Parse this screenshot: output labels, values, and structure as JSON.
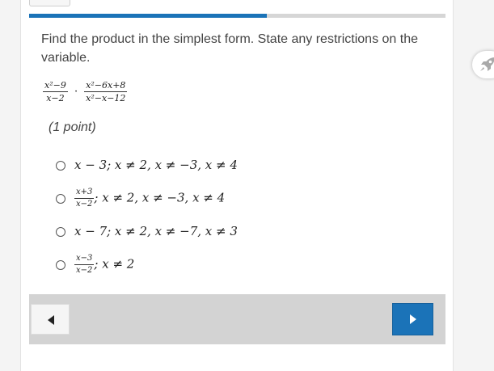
{
  "progress": {
    "fraction": 0.57
  },
  "question": {
    "prompt": "Find the product in the simplest form. State any restrictions on the variable.",
    "expression": {
      "first_num": "x²−9",
      "first_den": "x−2",
      "operator": "·",
      "second_num": "x²−6x+8",
      "second_den": "x²−x−12"
    },
    "points_label": "(1 point)"
  },
  "options": [
    {
      "text": "x − 3; x ≠ 2, x ≠ −3, x ≠ 4"
    },
    {
      "num": "x+3",
      "den": "x−2",
      "rest": "; x ≠ 2, x ≠ −3, x ≠ 4"
    },
    {
      "text": "x − 7; x ≠ 2, x ≠ −7, x ≠ 3"
    },
    {
      "num": "x−3",
      "den": "x−2",
      "rest": "; x ≠ 2"
    }
  ],
  "colors": {
    "accent": "#1b73b8",
    "nav_bar": "#d3d3d3",
    "track": "#d6d6d6"
  },
  "icons": {
    "previous": "caret-left-icon",
    "next": "caret-right-icon",
    "launcher": "rocket-icon"
  }
}
